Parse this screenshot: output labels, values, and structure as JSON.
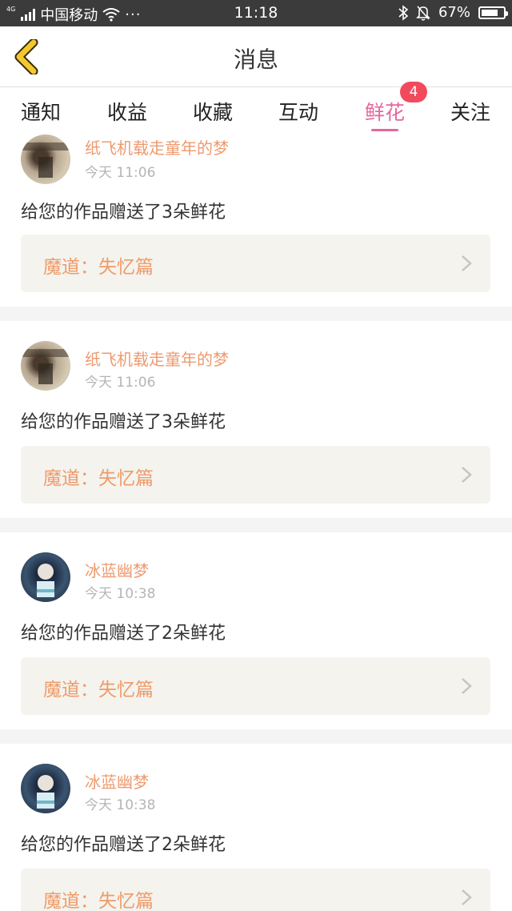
{
  "status_bar": {
    "network": "4G",
    "carrier": "中国移动",
    "more": "···",
    "time": "11:18",
    "battery": "67%"
  },
  "header": {
    "title": "消息"
  },
  "tabs": [
    {
      "label": "通知"
    },
    {
      "label": "收益"
    },
    {
      "label": "收藏"
    },
    {
      "label": "互动"
    },
    {
      "label": "鲜花",
      "active": true,
      "badge": "4"
    },
    {
      "label": "关注"
    }
  ],
  "messages": [
    {
      "user": "纸飞机载走童年的梦",
      "time": "今天 11:06",
      "text": "给您的作品赠送了3朵鲜花",
      "work": "魔道：失忆篇"
    },
    {
      "user": "纸飞机载走童年的梦",
      "time": "今天 11:06",
      "text": "给您的作品赠送了3朵鲜花",
      "work": "魔道：失忆篇"
    },
    {
      "user": "冰蓝幽梦",
      "time": "今天 10:38",
      "text": "给您的作品赠送了2朵鲜花",
      "work": "魔道：失忆篇"
    },
    {
      "user": "冰蓝幽梦",
      "time": "今天 10:38",
      "text": "给您的作品赠送了2朵鲜花",
      "work": "魔道：失忆篇"
    }
  ],
  "colors": {
    "accent": "#e4679e",
    "badge": "#f14a5d",
    "name": "#ee9a6f",
    "work_title": "#ef9b6a",
    "card_bg": "#f4f3ee",
    "back_icon": "#f2c832"
  }
}
